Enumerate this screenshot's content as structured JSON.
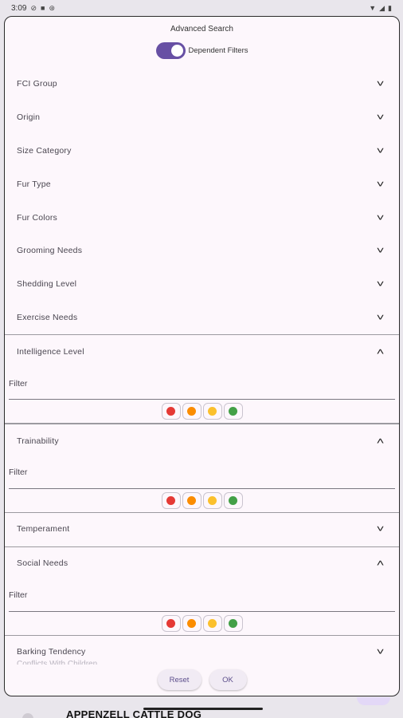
{
  "statusbar": {
    "time": "3:09"
  },
  "dialog": {
    "title": "Advanced Search",
    "dependent_filters": {
      "label": "Dependent Filters",
      "on": true
    },
    "sections": [
      {
        "label": "FCI Group",
        "expanded": false
      },
      {
        "label": "Origin",
        "expanded": false
      },
      {
        "label": "Size Category",
        "expanded": false
      },
      {
        "label": "Fur Type",
        "expanded": false
      },
      {
        "label": "Fur Colors",
        "expanded": false
      },
      {
        "label": "Grooming Needs",
        "expanded": false
      },
      {
        "label": "Shedding Level",
        "expanded": false
      },
      {
        "label": "Exercise Needs",
        "expanded": false
      },
      {
        "label": "Intelligence Level",
        "expanded": true,
        "filter_placeholder": "Filter"
      },
      {
        "label": "Trainability",
        "expanded": true,
        "filter_placeholder": "Filter"
      },
      {
        "label": "Temperament",
        "expanded": false
      },
      {
        "label": "Social Needs",
        "expanded": true,
        "filter_placeholder": "Filter"
      },
      {
        "label": "Barking Tendency",
        "expanded": false
      }
    ],
    "level_colors": [
      "#e53935",
      "#fb8c00",
      "#fbc02d",
      "#43a047"
    ],
    "partial_next_label": "Conflicts With Children",
    "buttons": {
      "reset": "Reset",
      "ok": "OK"
    }
  },
  "background": {
    "title": "APPENZELL CATTLE DOG"
  }
}
